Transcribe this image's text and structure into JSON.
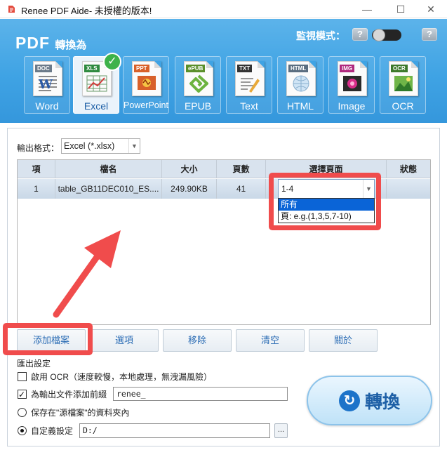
{
  "window": {
    "title": "Renee PDF Aide- 未授權的版本!",
    "minimize": "—",
    "maximize": "☐",
    "close": "✕"
  },
  "header": {
    "brand": "PDF",
    "subtitle": "轉換為",
    "monitor_label": "監視模式：",
    "help": "?",
    "monitor_on": false
  },
  "formats": [
    {
      "tag": "DOC",
      "label": "Word",
      "active": false
    },
    {
      "tag": "XLS",
      "label": "Excel",
      "active": true
    },
    {
      "tag": "PPT",
      "label": "PowerPoint",
      "active": false
    },
    {
      "tag": "ePUB",
      "label": "EPUB",
      "active": false
    },
    {
      "tag": "TXT",
      "label": "Text",
      "active": false
    },
    {
      "tag": "HTML",
      "label": "HTML",
      "active": false
    },
    {
      "tag": "IMG",
      "label": "Image",
      "active": false
    },
    {
      "tag": "OCR",
      "label": "OCR",
      "active": false
    }
  ],
  "output_format": {
    "label": "輸出格式：",
    "value": "Excel (*.xlsx)"
  },
  "table": {
    "columns": [
      "項",
      "檔名",
      "大小",
      "頁數",
      "選擇頁面",
      "狀態"
    ],
    "rows": [
      {
        "index": "1",
        "filename": "table_GB11DEC010_ES....",
        "size": "249.90KB",
        "pages": "41",
        "selection": "1-4",
        "status": ""
      }
    ]
  },
  "page_dropdown": {
    "options": [
      "所有",
      "頁: e.g.(1,3,5,7-10)"
    ],
    "selected_index": 0
  },
  "buttons": {
    "add": "添加檔案",
    "options": "選項",
    "remove": "移除",
    "clear": "清空",
    "about": "關於"
  },
  "settings": {
    "title": "匯出設定",
    "ocr_label": "啟用 OCR（速度較慢，本地處理，無洩漏風險）",
    "ocr_checked": false,
    "prefix_label": "為輸出文件添加前綴",
    "prefix_checked": true,
    "prefix_value": "renee_",
    "save_source_label": "保存在\"源檔案\"的資料夾內",
    "save_source_selected": false,
    "custom_label": "自定義設定",
    "custom_selected": true,
    "custom_path": "D:/",
    "browse": "..."
  },
  "convert": {
    "label": "轉換",
    "icon": "refresh-icon"
  },
  "colors": {
    "header_blue": "#3fa3e4",
    "highlight_red": "#f04c4c",
    "selection_blue": "#0a64d7",
    "button_text": "#2c6db5"
  }
}
